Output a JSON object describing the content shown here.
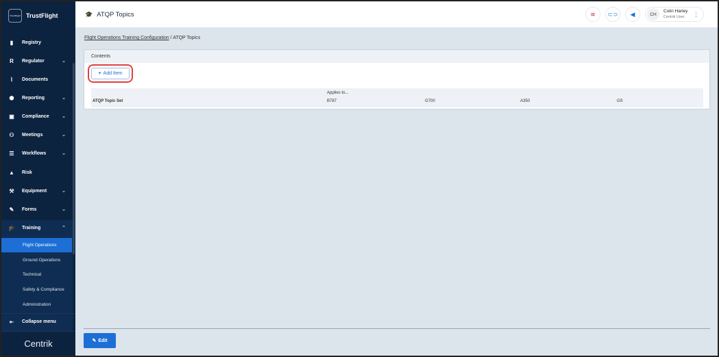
{
  "sidebar": {
    "brand": "TrustFlight",
    "brand_logo_text": "TrustFlight",
    "items": [
      {
        "label": "Registry",
        "icon": "▮"
      },
      {
        "label": "Regulator",
        "icon": "R",
        "chevron": true
      },
      {
        "label": "Documents",
        "icon": "⌇"
      },
      {
        "label": "Reporting",
        "icon": "⬢",
        "chevron": true
      },
      {
        "label": "Compliance",
        "icon": "▣",
        "chevron": true
      },
      {
        "label": "Meetings",
        "icon": "⚇",
        "chevron": true
      },
      {
        "label": "Workflows",
        "icon": "☰",
        "chevron": true
      },
      {
        "label": "Risk",
        "icon": "▲"
      },
      {
        "label": "Equipment",
        "icon": "⚒",
        "chevron": true
      },
      {
        "label": "Forms",
        "icon": "✎",
        "chevron": true
      },
      {
        "label": "Training",
        "icon": "🎓",
        "chevron": true,
        "open": true
      }
    ],
    "sub_items": [
      "Flight Operations",
      "Ground Operations",
      "Technical",
      "Safety & Compliance",
      "Administration"
    ],
    "collapse": "Collapse menu",
    "footer_logo": "Centrik"
  },
  "header": {
    "title": "ATQP Topics",
    "user_initials": "CH",
    "user_name": "Colin Harley",
    "user_role": "Centrik User"
  },
  "breadcrumb": {
    "parent": "Flight Operations Training Configuration",
    "current": "ATQP Topics"
  },
  "panel": {
    "title": "Contents",
    "add_button": "Add Item",
    "applies_to": "Applies to...",
    "columns": [
      "ATQP Topic Set",
      "B787",
      "G700",
      "A350",
      "GS"
    ]
  },
  "footer": {
    "edit": "Edit"
  }
}
